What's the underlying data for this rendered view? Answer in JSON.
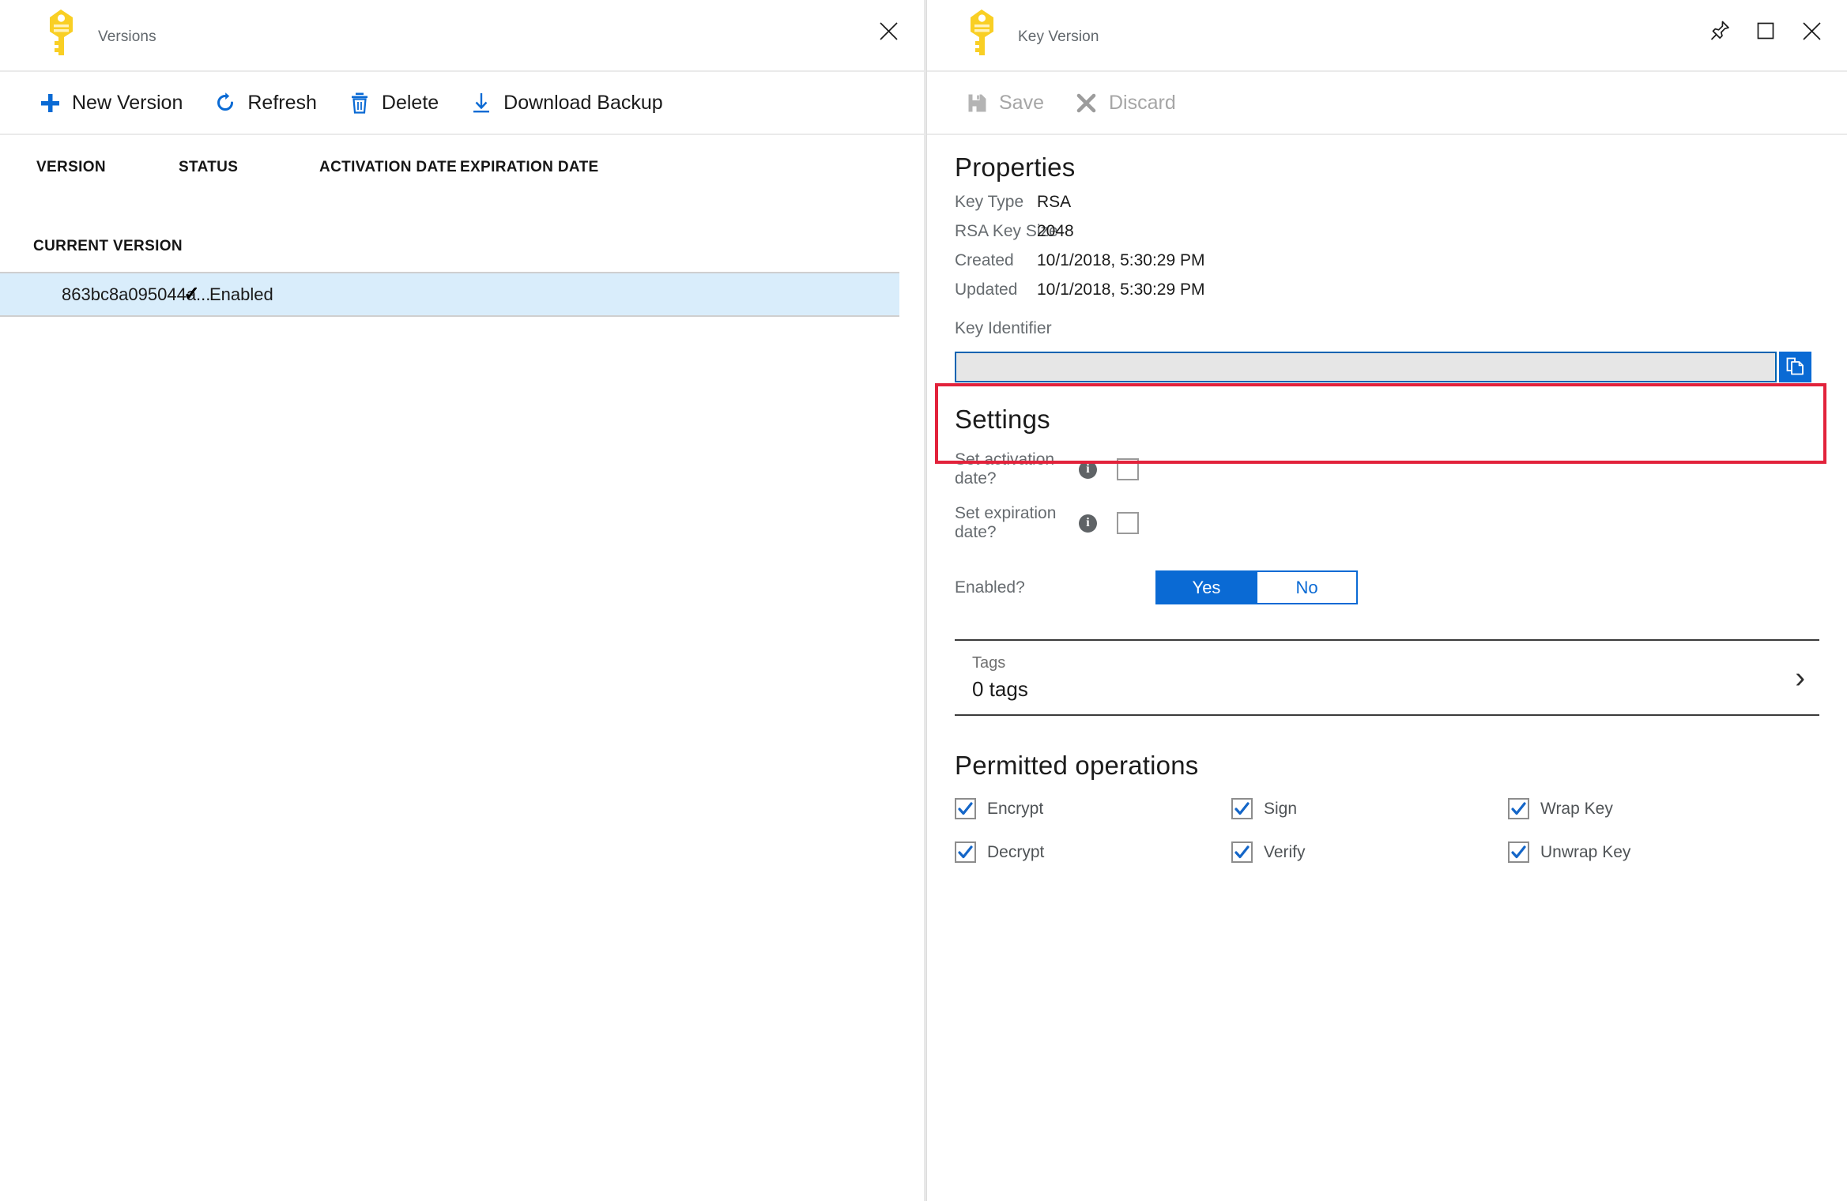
{
  "left_blade": {
    "icon": "key-icon",
    "title": "Versions",
    "close_label": "✕",
    "commands": [
      {
        "icon": "plus-icon",
        "label": "New Version"
      },
      {
        "icon": "refresh-icon",
        "label": "Refresh"
      },
      {
        "icon": "trash-icon",
        "label": "Delete"
      },
      {
        "icon": "download-icon",
        "label": "Download Backup"
      }
    ],
    "grid": {
      "columns": [
        "VERSION",
        "STATUS",
        "ACTIVATION DATE",
        "EXPIRATION DATE"
      ],
      "group_label": "CURRENT VERSION",
      "rows": [
        {
          "version": "863bc8a095044a...",
          "status": "Enabled",
          "status_icon": "check-icon",
          "activation_date": "",
          "expiration_date": "",
          "selected": true
        }
      ]
    }
  },
  "right_blade": {
    "icon": "key-icon",
    "title": "Key Version",
    "window_controls": [
      {
        "name": "pin-icon",
        "label": "Pin"
      },
      {
        "name": "maximize-icon",
        "label": "Maximize"
      },
      {
        "name": "close-icon",
        "label": "Close"
      }
    ],
    "commands": [
      {
        "icon": "save-icon",
        "label": "Save",
        "disabled": true
      },
      {
        "icon": "discard-icon",
        "label": "Discard",
        "disabled": true
      }
    ],
    "properties": {
      "title": "Properties",
      "rows": [
        {
          "label": "Key Type",
          "value": "RSA"
        },
        {
          "label": "RSA Key Size",
          "value": "2048"
        },
        {
          "label": "Created",
          "value": "10/1/2018, 5:30:29 PM"
        },
        {
          "label": "Updated",
          "value": "10/1/2018, 5:30:29 PM"
        }
      ]
    },
    "key_identifier": {
      "label": "Key Identifier",
      "value": "",
      "placeholder": "",
      "copy_button": "copy-icon",
      "highlight_color": "#e2223b"
    },
    "settings": {
      "title": "Settings",
      "activation": {
        "label": "Set activation date?",
        "info": "i",
        "checked": false
      },
      "expiration": {
        "label": "Set expiration date?",
        "info": "i",
        "checked": false
      },
      "enabled": {
        "label": "Enabled?",
        "yes_label": "Yes",
        "no_label": "No",
        "selected": "Yes"
      }
    },
    "tags": {
      "label": "Tags",
      "value": "0 tags",
      "chevron": "›"
    },
    "permitted_operations": {
      "title": "Permitted operations",
      "items": [
        {
          "label": "Encrypt",
          "checked": true
        },
        {
          "label": "Sign",
          "checked": true
        },
        {
          "label": "Wrap Key",
          "checked": true
        },
        {
          "label": "Decrypt",
          "checked": true
        },
        {
          "label": "Verify",
          "checked": true
        },
        {
          "label": "Unwrap Key",
          "checked": true
        }
      ]
    }
  },
  "colors": {
    "accent_blue": "#0a6ad4",
    "key_yellow": "#f5c518",
    "highlight_red": "#e2223b",
    "row_selected": "#d9edfb"
  }
}
